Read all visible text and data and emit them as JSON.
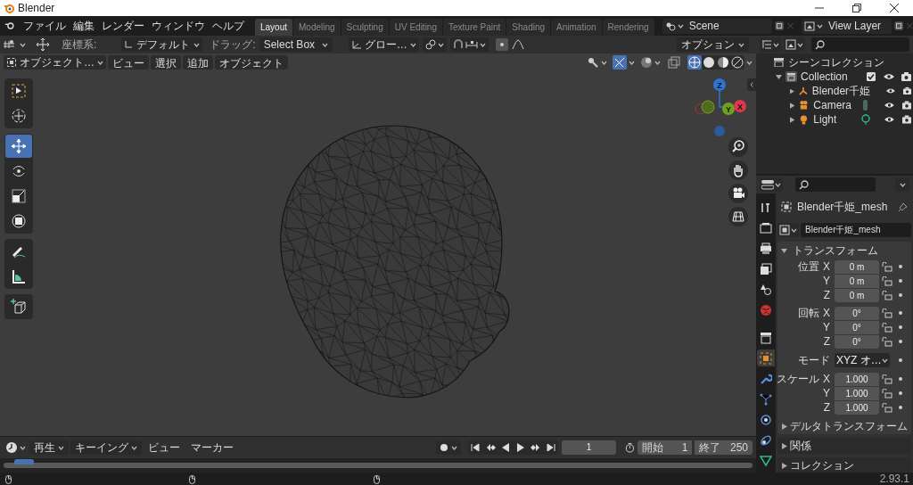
{
  "window": {
    "title": "Blender"
  },
  "menu": [
    "ファイル",
    "編集",
    "レンダー",
    "ウィンドウ",
    "ヘルプ"
  ],
  "workspaces": [
    {
      "label": "Layout",
      "selected": true
    },
    {
      "label": "Modeling",
      "selected": false
    },
    {
      "label": "Sculpting",
      "selected": false
    },
    {
      "label": "UV Editing",
      "selected": false
    },
    {
      "label": "Texture Paint",
      "selected": false
    },
    {
      "label": "Shading",
      "selected": false
    },
    {
      "label": "Animation",
      "selected": false
    },
    {
      "label": "Rendering",
      "selected": false
    }
  ],
  "scene": "Scene",
  "view_layer": "View Layer",
  "tool_header": {
    "orientation_label": "座標系:",
    "orientation": "デフォルト",
    "drag_label": "ドラッグ:",
    "drag": "Select Box",
    "transform_orientation": "グロー…",
    "options": "オプション"
  },
  "viewport_header": {
    "mode": "オブジェクト…",
    "menus": [
      "ビュー",
      "選択",
      "追加",
      "オブジェクト"
    ]
  },
  "toolbar": [
    [
      {
        "kind": "select",
        "selected": false
      },
      {
        "kind": "cursor",
        "selected": false
      }
    ],
    [
      {
        "kind": "move",
        "selected": true
      },
      {
        "kind": "rotate",
        "selected": false
      },
      {
        "kind": "scale",
        "selected": false
      },
      {
        "kind": "transform",
        "selected": false
      }
    ],
    [
      {
        "kind": "annotate",
        "selected": false
      },
      {
        "kind": "measure",
        "selected": false
      }
    ],
    [
      {
        "kind": "add-cube",
        "selected": false
      }
    ]
  ],
  "gizmo": [
    {
      "label": "Z",
      "color": "#2f74d0"
    },
    {
      "label": "Y",
      "color": "#6fa11c"
    },
    {
      "label": "X",
      "color": "#e0364f"
    }
  ],
  "outliner": {
    "root": "シーンコレクション",
    "collection": {
      "label": "Collection",
      "checked": true,
      "expanded": true,
      "children": [
        {
          "label": "Blender千姫",
          "kind": "mesh"
        },
        {
          "label": "Camera",
          "kind": "camera"
        },
        {
          "label": "Light",
          "kind": "light"
        }
      ]
    }
  },
  "properties": {
    "object_name": "Blender千姫_mesh",
    "data_name": "Blender千姫_mesh",
    "tabs": [
      {
        "kind": "tool",
        "selected": false
      },
      {
        "kind": "render",
        "selected": false
      },
      {
        "kind": "output",
        "selected": false
      },
      {
        "kind": "view-layer",
        "selected": false
      },
      {
        "kind": "scene",
        "selected": false
      },
      {
        "kind": "world",
        "selected": false
      },
      {
        "kind": "collection",
        "selected": false
      },
      {
        "kind": "object",
        "selected": true
      },
      {
        "kind": "modifier",
        "selected": false
      },
      {
        "kind": "particles",
        "selected": false
      },
      {
        "kind": "physics",
        "selected": false
      },
      {
        "kind": "constraints",
        "selected": false
      },
      {
        "kind": "data",
        "selected": false
      }
    ],
    "transform": {
      "title": "トランスフォーム",
      "expanded": true,
      "groups": [
        {
          "kind": "vector",
          "label": "位置",
          "axes": [
            "X",
            "Y",
            "Z"
          ],
          "values": [
            "0 m",
            "0 m",
            "0 m"
          ]
        },
        {
          "kind": "vector",
          "label": "回転",
          "axes": [
            "X",
            "Y",
            "Z"
          ],
          "values": [
            "0°",
            "0°",
            "0°"
          ]
        },
        {
          "kind": "dropdown",
          "label": "モード",
          "value": "XYZ オ…"
        },
        {
          "kind": "vector",
          "label": "スケール",
          "axes": [
            "X",
            "Y",
            "Z"
          ],
          "values": [
            "1.000",
            "1.000",
            "1.000"
          ]
        }
      ]
    },
    "subpanels": [
      {
        "title": "デルタトランスフォーム",
        "nested": true
      },
      {
        "title": "関係",
        "nested": false
      },
      {
        "title": "コレクション",
        "nested": false
      }
    ]
  },
  "timeline": {
    "menus": [
      {
        "label": "再生",
        "dropdown": true
      },
      {
        "label": "キーイング",
        "dropdown": true
      },
      {
        "label": "ビュー",
        "dropdown": false
      },
      {
        "label": "マーカー",
        "dropdown": false
      }
    ],
    "current_frame": "1",
    "start_label": "開始",
    "start": "1",
    "end_label": "終了",
    "end": "250"
  },
  "status_bar": {
    "version": "2.93.1"
  }
}
